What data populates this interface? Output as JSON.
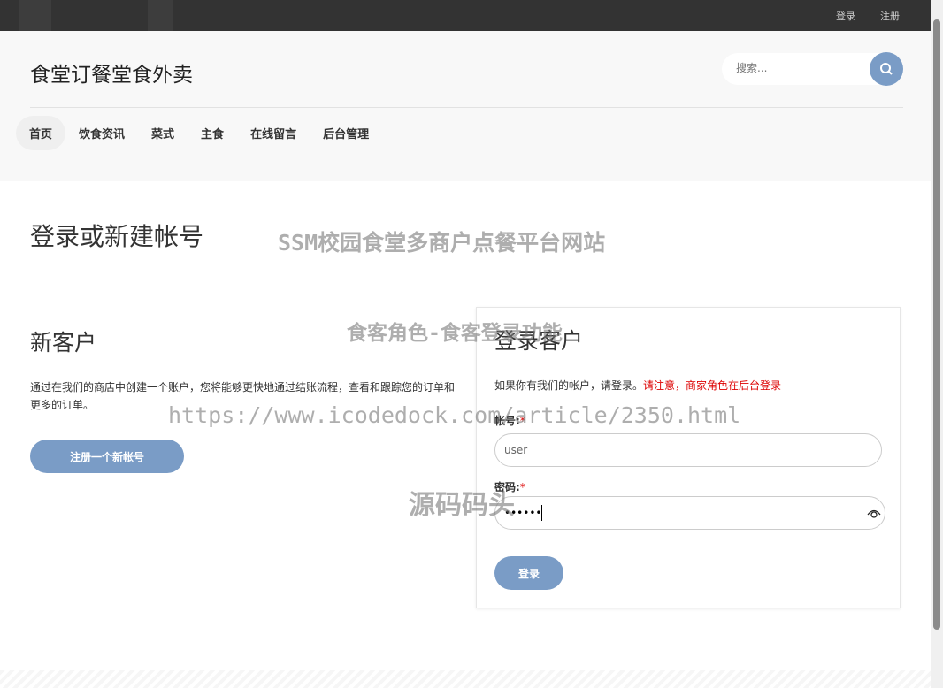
{
  "topbar": {
    "login": "登录",
    "register": "注册"
  },
  "header": {
    "logo": "食堂订餐堂食外卖",
    "search_placeholder": "搜索...",
    "nav": [
      "首页",
      "饮食资讯",
      "菜式",
      "主食",
      "在线留言",
      "后台管理"
    ]
  },
  "main": {
    "title": "登录或新建帐号",
    "new_customer": {
      "heading": "新客户",
      "text": "通过在我们的商店中创建一个账户，您将能够更快地通过结账流程，查看和跟踪您的订单和更多的订单。",
      "button": "注册一个新帐号"
    },
    "login": {
      "heading": "登录客户",
      "note": "如果你有我们的帐户，请登录。",
      "warning": "请注意，商家角色在后台登录",
      "account_label": "帐号:",
      "password_label": "密码:",
      "required": "*",
      "account_value": "user",
      "password_value": "••••••",
      "submit": "登录"
    }
  },
  "watermarks": [
    "SSM校园食堂多商户点餐平台网站",
    "食客角色-食客登录功能",
    "https://www.icodedock.com/article/2350.html",
    "源码码头"
  ],
  "colors": {
    "accent": "#7a9cc6",
    "warning": "#dd0000",
    "topbar": "#333333"
  }
}
